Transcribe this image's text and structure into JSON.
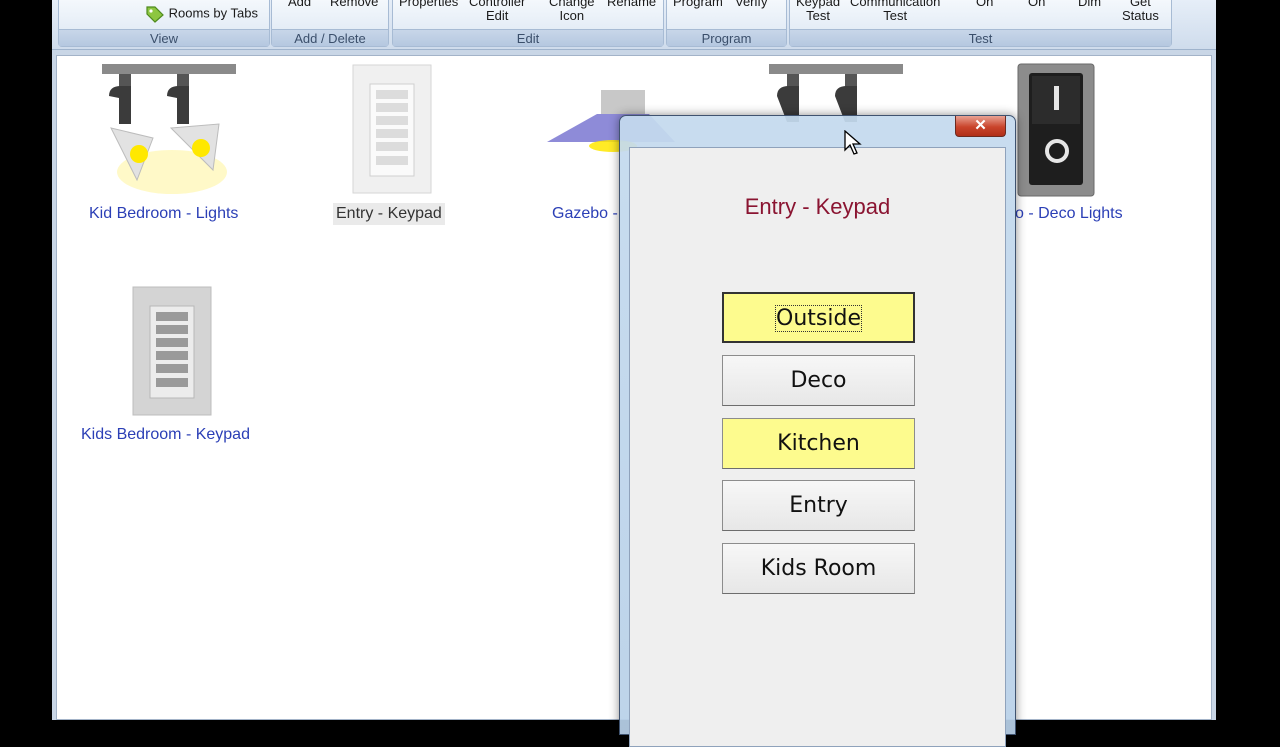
{
  "ribbon": {
    "view": {
      "rooms_by_tabs": "Rooms by Tabs",
      "group": "View"
    },
    "add_delete": {
      "add": "Add",
      "remove": "Remove",
      "group": "Add / Delete"
    },
    "edit": {
      "properties": "Properties",
      "controller": "Controller",
      "controller_2": "Edit",
      "change": "Change",
      "change_2": "Icon",
      "rename": "Rename",
      "group": "Edit"
    },
    "program": {
      "program": "Program",
      "verify": "Verify",
      "group": "Program"
    },
    "test": {
      "keypad": "Keypad",
      "keypad_2": "Test",
      "communication": "Communication",
      "communication_2": "Test",
      "on1": "On",
      "on2": "On",
      "dim": "Dim",
      "get": "Get",
      "get_2": "Status",
      "group": "Test"
    }
  },
  "devices": {
    "kid_bedroom_lights": "Kid Bedroom - Lights",
    "entry_keypad": "Entry - Keypad",
    "gazebo": "Gazebo -",
    "deco_lights": "o - Deco Lights",
    "kids_bedroom_keypad": "Kids Bedroom - Keypad"
  },
  "dialog": {
    "title": "Entry - Keypad",
    "close": "✕",
    "buttons": [
      "Outside",
      "Deco",
      "Kitchen",
      "Entry",
      "Kids Room"
    ]
  },
  "colors": {
    "lit": "#fdfb8e",
    "title": "#8a1431",
    "link": "#2b3fb6"
  }
}
